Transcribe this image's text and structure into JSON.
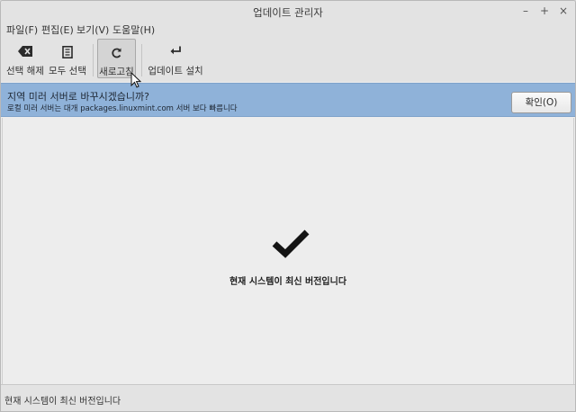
{
  "window": {
    "title": "업데이트 관리자"
  },
  "window_controls": [
    "–",
    "+",
    "×"
  ],
  "menubar": {
    "items": [
      {
        "label": "파일(F)"
      },
      {
        "label": "편집(E)"
      },
      {
        "label": "보기(V)"
      },
      {
        "label": "도움말(H)"
      }
    ]
  },
  "toolbar": {
    "clear_label": "선택 해제",
    "select_all_label": "모두 선택",
    "refresh_label": "새로고침",
    "install_label": "업데이트 설치",
    "refresh_pressed": true
  },
  "infobar": {
    "title": "지역 미러 서버로 바꾸시겠습니까?",
    "subtitle": "로컬 미러 서버는 대개 packages.linuxmint.com 서버 보다 빠릅니다",
    "ok_label": "확인(O)",
    "color": "#8fb2d9"
  },
  "main": {
    "message": "현재 시스템이 최신 버전입니다",
    "icon": "checkmark-icon"
  },
  "statusbar": {
    "text": "현재 시스템이 최신 버전입니다"
  }
}
